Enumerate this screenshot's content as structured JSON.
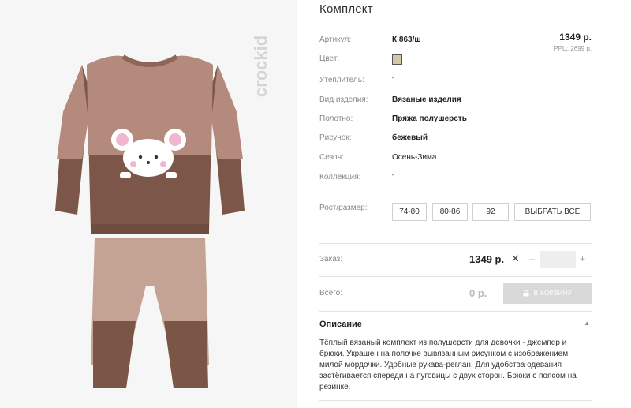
{
  "product": {
    "title": "Комплект",
    "brand": "crockid"
  },
  "price": {
    "main": "1349 р.",
    "rrc": "РРЦ: 2699 р."
  },
  "attributes": [
    {
      "label": "Артикул:",
      "value": "К 863/ш",
      "bold": true
    },
    {
      "label": "Цвет:",
      "value": ""
    },
    {
      "label": "Утеплитель:",
      "value": "\""
    },
    {
      "label": "Вид изделия:",
      "value": "Вязаные изделия",
      "bold": true
    },
    {
      "label": "Полотно:",
      "value": "Пряжа полушерсть",
      "bold": true
    },
    {
      "label": "Рисунок:",
      "value": "бежевый",
      "bold": true
    },
    {
      "label": "Сезон:",
      "value": "Осень-Зима"
    },
    {
      "label": "Коллекция:",
      "value": "\""
    },
    {
      "label": "Рост/размер:",
      "value": ""
    }
  ],
  "color_swatch": "#d6c7a8",
  "sizes": [
    "74-80",
    "80-86",
    "92"
  ],
  "select_all_label": "ВЫБРАТЬ ВСЕ",
  "order": {
    "label": "Заказ:",
    "price": "1349 р.",
    "times": "✕",
    "minus": "–",
    "plus": "+",
    "quantity": ""
  },
  "total": {
    "label": "Всего:",
    "price": "0 р.",
    "cart_button": "В КОРЗИНУ"
  },
  "description": {
    "heading": "Описание",
    "text": "Тёплый вязаный комплект из полушерсти для девочки - джемпер и брюки. Украшен на полочке вывязанным рисунком с изображением милой мордочки. Удобные рукава-реглан. Для удобства одевания застёгивается спереди на пуговицы с двух сторон. Брюки с поясом на резинке."
  },
  "colors": {
    "sweater_light": "#b48a7c",
    "sweater_dark": "#7c5648",
    "trousers_light": "#c4a394",
    "trousers_dark": "#7b5646"
  }
}
